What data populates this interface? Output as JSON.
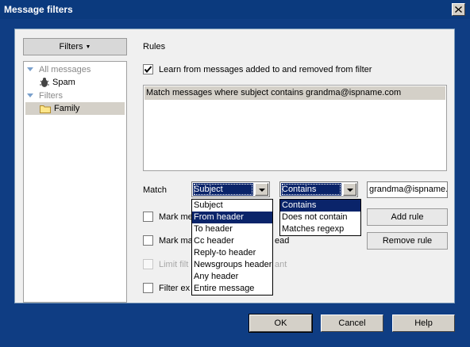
{
  "window": {
    "title": "Message filters"
  },
  "sidebar": {
    "filters_button_label": "Filters",
    "tree": [
      {
        "label": "All messages",
        "type": "group"
      },
      {
        "label": "Spam",
        "type": "item"
      },
      {
        "label": "Filters",
        "type": "group"
      },
      {
        "label": "Family",
        "type": "item",
        "selected": true
      }
    ]
  },
  "rules": {
    "heading": "Rules",
    "learn_label": "Learn from messages added to and removed from filter",
    "learn_checked": true,
    "list": [
      "Match messages where subject contains grandma@ispname.com"
    ]
  },
  "match": {
    "label": "Match",
    "field_value": "Subject",
    "operator_value": "Contains",
    "text_value": "grandma@ispname.c",
    "field_options": [
      "Subject",
      "From header",
      "To header",
      "Cc header",
      "Reply-to header",
      "Newsgroups header",
      "Any header",
      "Entire message"
    ],
    "field_highlighted": "From header",
    "operator_options": [
      "Contains",
      "Does not contain",
      "Matches regexp"
    ],
    "operator_highlighted": "Contains"
  },
  "buttons": {
    "add_rule": "Add rule",
    "remove_rule": "Remove rule",
    "ok": "OK",
    "cancel": "Cancel",
    "help": "Help"
  },
  "options": [
    {
      "label": "Mark me",
      "suffix": "",
      "disabled": false
    },
    {
      "label": "Mark ma",
      "suffix": "ead",
      "disabled": false
    },
    {
      "label": "Limit filt",
      "suffix": "ant",
      "disabled": true
    },
    {
      "label": "Filter ex",
      "suffix": "",
      "disabled": false
    }
  ],
  "colors": {
    "title_bar": "#0b3a7e",
    "selection": "#0a246a",
    "dialog_bg": "#f0f0f0"
  }
}
